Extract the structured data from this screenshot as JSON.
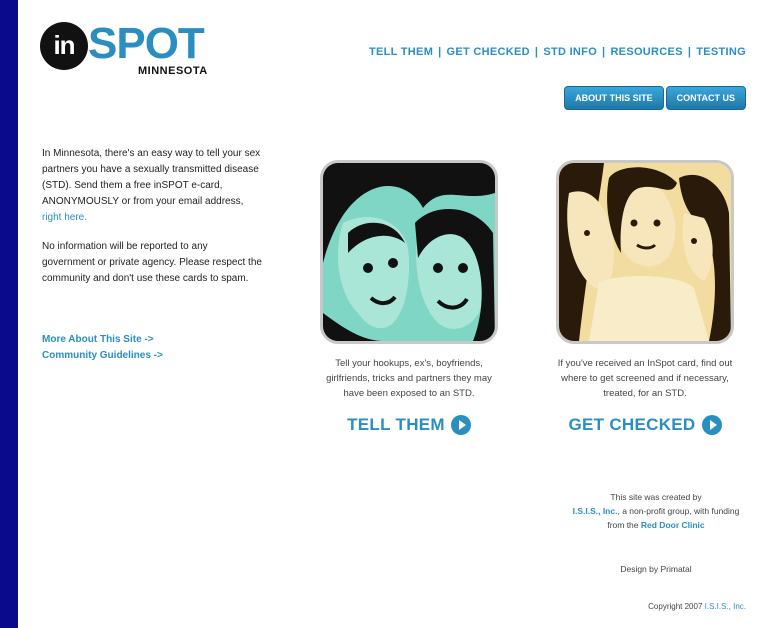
{
  "logo": {
    "mark": "in",
    "brand": "SPOT",
    "state": "MINNESOTA"
  },
  "nav": [
    "TELL THEM",
    "GET CHECKED",
    "STD INFO",
    "RESOURCES",
    "TESTING"
  ],
  "buttons": {
    "about": "ABOUT THIS SITE",
    "contact": "CONTACT US"
  },
  "intro": {
    "p1_a": "In Minnesota, there's an easy way to tell your sex partners you have a sexually transmitted disease (STD). Send them a free inSPOT e-card, ANONYMOUSLY or from your email address,",
    "p1_link": "right here.",
    "p2": "No information will be reported to any government or private agency. Please respect the community and don't use these cards to spam."
  },
  "links": {
    "more_about": "More About This Site ->",
    "guidelines": "Community Guidelines ->"
  },
  "cards": {
    "tell": {
      "desc": "Tell your hookups, ex's, boyfriends, girlfriends, tricks and partners they may have been exposed to an STD.",
      "cta": "TELL THEM"
    },
    "check": {
      "desc": "If you've received an InSpot card, find out where to get screened and if necessary, treated, for an STD.",
      "cta": "GET CHECKED"
    }
  },
  "credit": {
    "line1": "This site was created by",
    "isis": "I.S.I.S., Inc.",
    "line2": ", a non-profit group, with funding from the",
    "clinic": "Red Door Clinic",
    "design": "Design by Primatal"
  },
  "copyright": {
    "text": "Copyright 2007",
    "owner": "I.S.I.S., Inc."
  },
  "colors": {
    "accent": "#2a8fc0",
    "frame": "#0a0a8c",
    "tell_tint": "#7fd6c4",
    "check_tint": "#f3dca0"
  }
}
